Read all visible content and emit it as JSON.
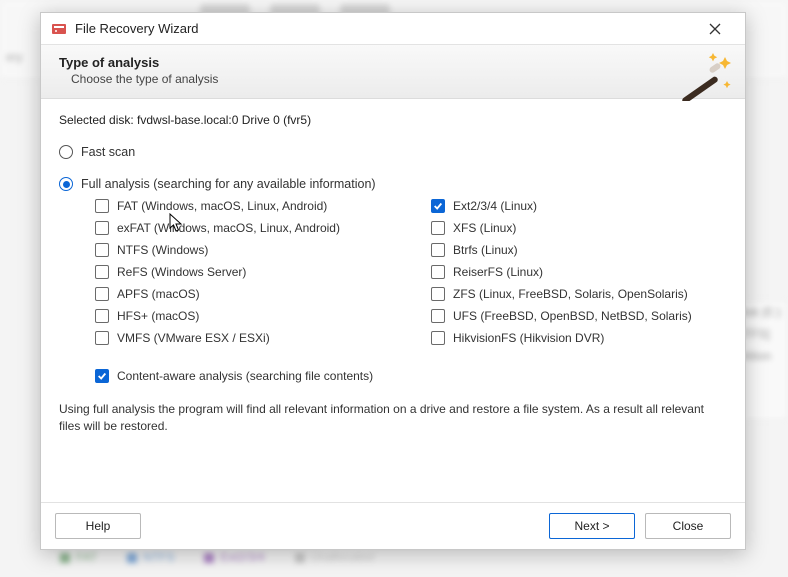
{
  "window": {
    "title": "File Recovery Wizard"
  },
  "header": {
    "heading": "Type of analysis",
    "sub": "Choose the type of analysis"
  },
  "selected_disk": {
    "label": "Selected disk: ",
    "value": "fvdwsl-base.local:0 Drive 0 (fvr5)"
  },
  "scan": {
    "fast_label": "Fast scan",
    "full_label": "Full analysis (searching for any available information)",
    "selected": "full"
  },
  "fs": [
    {
      "id": "fat",
      "label": "FAT (Windows, macOS, Linux, Android)",
      "checked": false
    },
    {
      "id": "exfat",
      "label": "exFAT (Windows, macOS, Linux, Android)",
      "checked": false
    },
    {
      "id": "ntfs",
      "label": "NTFS (Windows)",
      "checked": false
    },
    {
      "id": "refs",
      "label": "ReFS (Windows Server)",
      "checked": false
    },
    {
      "id": "apfs",
      "label": "APFS (macOS)",
      "checked": false
    },
    {
      "id": "hfsplus",
      "label": "HFS+ (macOS)",
      "checked": false
    },
    {
      "id": "vmfs",
      "label": "VMFS (VMware ESX / ESXi)",
      "checked": false
    },
    {
      "id": "ext",
      "label": "Ext2/3/4 (Linux)",
      "checked": true
    },
    {
      "id": "xfs",
      "label": "XFS (Linux)",
      "checked": false
    },
    {
      "id": "btrfs",
      "label": "Btrfs (Linux)",
      "checked": false
    },
    {
      "id": "reiser",
      "label": "ReiserFS (Linux)",
      "checked": false
    },
    {
      "id": "zfs",
      "label": "ZFS (Linux, FreeBSD, Solaris, OpenSolaris)",
      "checked": false
    },
    {
      "id": "ufs",
      "label": "UFS (FreeBSD, OpenBSD, NetBSD, Solaris)",
      "checked": false
    },
    {
      "id": "hikfs",
      "label": "HikvisionFS (Hikvision DVR)",
      "checked": false
    }
  ],
  "content_aware": {
    "label": "Content-aware analysis (searching file contents)",
    "checked": true
  },
  "description": "Using full analysis the program will find all relevant information on a drive and restore a file system. As a result all relevant files will be restored.",
  "buttons": {
    "help": "Help",
    "next": "Next >",
    "close": "Close"
  },
  "background": {
    "right_panel": {
      "line1": "Disk (E:)",
      "line2": "NTFS]",
      "line3": "artition"
    },
    "legend": {
      "fat": "FAT",
      "ntfs": "NTFS",
      "ext": "Ext2/3/4",
      "un": "Unallocated"
    },
    "sidebar_stub": "ery"
  }
}
